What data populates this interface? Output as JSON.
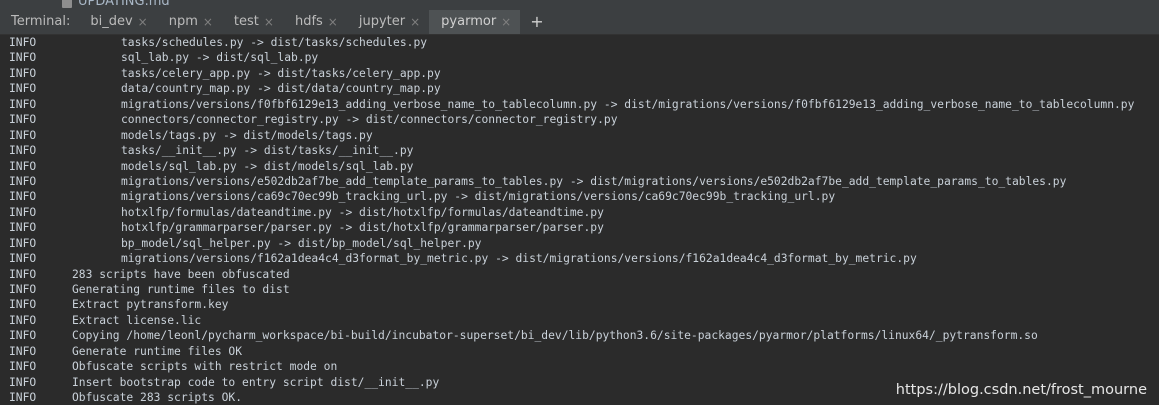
{
  "background_file": {
    "name": "UPDATING.md",
    "icon": "file-icon"
  },
  "tabbar": {
    "label": "Terminal:",
    "tabs": [
      {
        "label": "bi_dev",
        "active": false
      },
      {
        "label": "npm",
        "active": false
      },
      {
        "label": "test",
        "active": false
      },
      {
        "label": "hdfs",
        "active": false
      },
      {
        "label": "jupyter",
        "active": false
      },
      {
        "label": "pyarmor",
        "active": true
      }
    ],
    "close_glyph": "×",
    "add_glyph": "+"
  },
  "console": {
    "lines": [
      {
        "level": "INFO",
        "kind": "copy",
        "text": "tasks/schedules.py -> dist/tasks/schedules.py"
      },
      {
        "level": "INFO",
        "kind": "copy",
        "text": "sql_lab.py -> dist/sql_lab.py"
      },
      {
        "level": "INFO",
        "kind": "copy",
        "text": "tasks/celery_app.py -> dist/tasks/celery_app.py"
      },
      {
        "level": "INFO",
        "kind": "copy",
        "text": "data/country_map.py -> dist/data/country_map.py"
      },
      {
        "level": "INFO",
        "kind": "copy",
        "text": "migrations/versions/f0fbf6129e13_adding_verbose_name_to_tablecolumn.py -> dist/migrations/versions/f0fbf6129e13_adding_verbose_name_to_tablecolumn.py"
      },
      {
        "level": "INFO",
        "kind": "copy",
        "text": "connectors/connector_registry.py -> dist/connectors/connector_registry.py"
      },
      {
        "level": "INFO",
        "kind": "copy",
        "text": "models/tags.py -> dist/models/tags.py"
      },
      {
        "level": "INFO",
        "kind": "copy",
        "text": "tasks/__init__.py -> dist/tasks/__init__.py"
      },
      {
        "level": "INFO",
        "kind": "copy",
        "text": "models/sql_lab.py -> dist/models/sql_lab.py"
      },
      {
        "level": "INFO",
        "kind": "copy",
        "text": "migrations/versions/e502db2af7be_add_template_params_to_tables.py -> dist/migrations/versions/e502db2af7be_add_template_params_to_tables.py"
      },
      {
        "level": "INFO",
        "kind": "copy",
        "text": "migrations/versions/ca69c70ec99b_tracking_url.py -> dist/migrations/versions/ca69c70ec99b_tracking_url.py"
      },
      {
        "level": "INFO",
        "kind": "copy",
        "text": "hotxlfp/formulas/dateandtime.py -> dist/hotxlfp/formulas/dateandtime.py"
      },
      {
        "level": "INFO",
        "kind": "copy",
        "text": "hotxlfp/grammarparser/parser.py -> dist/hotxlfp/grammarparser/parser.py"
      },
      {
        "level": "INFO",
        "kind": "copy",
        "text": "bp_model/sql_helper.py -> dist/bp_model/sql_helper.py"
      },
      {
        "level": "INFO",
        "kind": "copy",
        "text": "migrations/versions/f162a1dea4c4_d3format_by_metric.py -> dist/migrations/versions/f162a1dea4c4_d3format_by_metric.py"
      },
      {
        "level": "INFO",
        "kind": "plain",
        "text": "283 scripts have been obfuscated"
      },
      {
        "level": "INFO",
        "kind": "plain",
        "text": "Generating runtime files to dist"
      },
      {
        "level": "INFO",
        "kind": "plain",
        "text": "Extract pytransform.key"
      },
      {
        "level": "INFO",
        "kind": "plain",
        "text": "Extract license.lic"
      },
      {
        "level": "INFO",
        "kind": "plain",
        "text": "Copying /home/leonl/pycharm_workspace/bi-build/incubator-superset/bi_dev/lib/python3.6/site-packages/pyarmor/platforms/linux64/_pytransform.so"
      },
      {
        "level": "INFO",
        "kind": "plain",
        "text": "Generate runtime files OK"
      },
      {
        "level": "INFO",
        "kind": "plain",
        "text": "Obfuscate scripts with restrict mode on"
      },
      {
        "level": "INFO",
        "kind": "plain",
        "text": "Insert bootstrap code to entry script dist/__init__.py"
      },
      {
        "level": "INFO",
        "kind": "plain",
        "text": "Obfuscate 283 scripts OK."
      }
    ]
  },
  "watermark": "https://blog.csdn.net/frost_mourne"
}
